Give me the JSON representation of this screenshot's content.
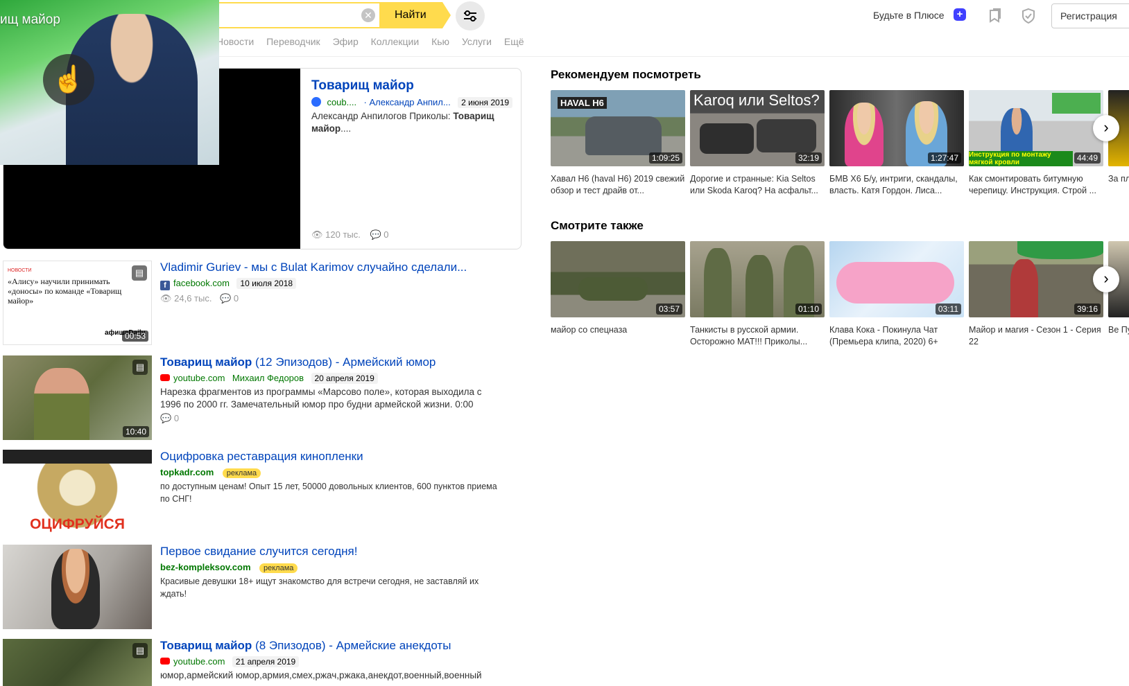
{
  "header": {
    "search_button": "Найти",
    "nav_tabs": [
      "Новости",
      "Переводчик",
      "Эфир",
      "Коллекции",
      "Кью",
      "Услуги",
      "Ещё"
    ],
    "plus_promo": "Будьте в Плюсе",
    "register_button": "Регистрация"
  },
  "pip": {
    "title": "ищ майор"
  },
  "main_result": {
    "title": "Товарищ майор",
    "source": "coub....",
    "author": "· Александр Анпил...",
    "date": "2 июня 2019",
    "snippet_plain": "Александр Анпилогов Приколы: ",
    "snippet_bold": "Товарищ майор",
    "snippet_tail": "....",
    "views": "120 тыс.",
    "comments": "0"
  },
  "results": [
    {
      "title_bold": "",
      "title_rest": "Vladimir Guriev - мы с Bulat Karimov случайно сделали...",
      "source": "facebook.com",
      "date": "10 июля 2018",
      "views": "24,6 тыс.",
      "comments": "0",
      "duration": "00:53",
      "thumb_tag": "новости",
      "thumb_text": "«Алису» научили принимать «доносы» по команде «Товарищ майор»",
      "thumb_logo": "афишаDaily"
    },
    {
      "title_bold": "Товарищ майор",
      "title_rest": " (12 Эпизодов) - Армейский юмор",
      "source": "youtube.com",
      "author": "Михаил Федоров",
      "date": "20 апреля 2019",
      "text": "Нарезка фрагментов из программы «Марсово поле», которая выходила с 1996 по 2000 гг. Замечательный юмор про будни армейской жизни. 0:00",
      "comments": "0",
      "duration": "10:40"
    },
    {
      "title": "Оцифровка реставрация кинопленки",
      "source": "topkadr.com",
      "ad_label": "реклама",
      "text": "по доступным ценам! Опыт 15 лет, 50000 довольных клиентов, 600 пунктов приема по СНГ!",
      "thumb_text": "ОЦИФРУЙСЯ"
    },
    {
      "title": "Первое свидание случится сегодня!",
      "source": "bez-kompleksov.com",
      "ad_label": "реклама",
      "text": "Красивые девушки 18+ ищут знакомство для встречи сегодня, не заставляй их ждать!"
    },
    {
      "title_bold": "Товарищ майор",
      "title_rest": " (8 Эпизодов) - Армейские анекдоты",
      "source": "youtube.com",
      "date": "21 апреля 2019",
      "text": "юмор,армейский юмор,армия,смех,ржач,ржака,анекдот,военный,военный"
    }
  ],
  "recommended": {
    "title": "Рекомендуем посмотреть",
    "items": [
      {
        "caption": "Хавал Н6 (haval H6) 2019 свежий обзор и тест драйв от...",
        "duration": "1:09:25",
        "thumb_text": "HAVAL H6"
      },
      {
        "caption": "Дорогие и странные: Kia Seltos или Skoda Karoq? На асфальт...",
        "duration": "32:19",
        "thumb_text": "Karoq или Seltos?"
      },
      {
        "caption": "БМВ Х6 Б/у, интриги, скандалы, власть. Катя Гордон. Лиса...",
        "duration": "1:27:47",
        "thumb_text": ""
      },
      {
        "caption": "Как смонтировать битумную черепицу. Инструкция. Строй ...",
        "duration": "44:49",
        "thumb_text": "Инструкция по монтажу мягкой кровли"
      },
      {
        "caption": "За пла",
        "duration": "",
        "thumb_text": ""
      }
    ]
  },
  "see_also": {
    "title": "Смотрите также",
    "items": [
      {
        "caption": "майор со спецназа",
        "duration": "03:57"
      },
      {
        "caption": "Танкисты в русской армии. Осторожно МАТ!!! Приколы...",
        "duration": "01:10"
      },
      {
        "caption": "Клава Кока - Покинула Чат (Премьера клипа, 2020) 6+",
        "duration": "03:11"
      },
      {
        "caption": "Майор и магия - Сезон 1 - Серия 22",
        "duration": "39:16"
      },
      {
        "caption": "Ве Пу",
        "duration": ""
      }
    ]
  },
  "colors": {
    "link": "#0044bb",
    "source_green": "#007700",
    "accent_yellow": "#ffdb4d"
  }
}
